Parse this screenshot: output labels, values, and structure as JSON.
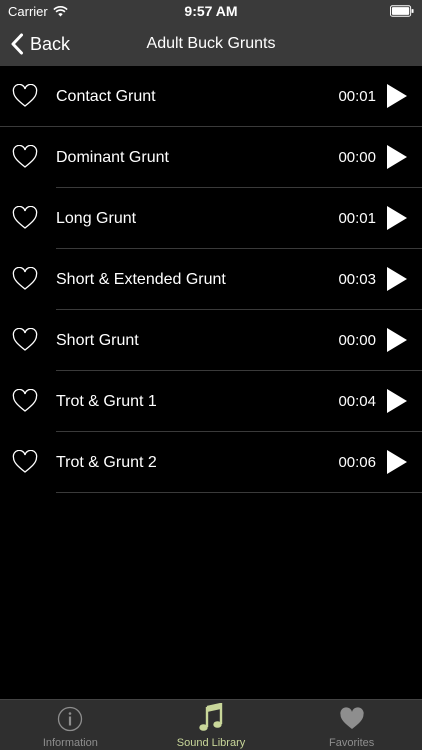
{
  "status_bar": {
    "carrier": "Carrier",
    "time": "9:57 AM"
  },
  "nav": {
    "back_label": "Back",
    "title": "Adult Buck Grunts"
  },
  "sounds": [
    {
      "name": "Contact Grunt",
      "duration": "00:01"
    },
    {
      "name": "Dominant Grunt",
      "duration": "00:00"
    },
    {
      "name": "Long Grunt",
      "duration": "00:01"
    },
    {
      "name": "Short & Extended Grunt",
      "duration": "00:03"
    },
    {
      "name": "Short Grunt",
      "duration": "00:00"
    },
    {
      "name": "Trot & Grunt 1",
      "duration": "00:04"
    },
    {
      "name": "Trot & Grunt 2",
      "duration": "00:06"
    }
  ],
  "tabs": [
    {
      "label": "Information",
      "icon": "info-icon",
      "active": false
    },
    {
      "label": "Sound Library",
      "icon": "music-note-icon",
      "active": true
    },
    {
      "label": "Favorites",
      "icon": "heart-icon",
      "active": false
    }
  ],
  "colors": {
    "accent": "#c9d79a",
    "bar_background": "#3a3a3a",
    "tab_background": "#2f2f2f",
    "background": "#000000"
  }
}
